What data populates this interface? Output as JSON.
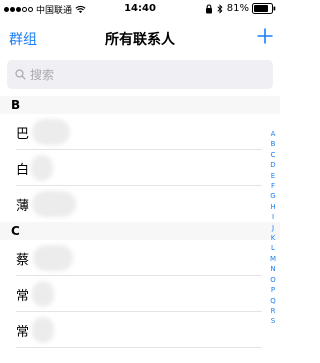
{
  "status_bar": {
    "carrier": "中国联通",
    "time": "14:40",
    "battery": "81%"
  },
  "nav": {
    "left_label": "群组",
    "title": "所有联系人",
    "add_symbol": "+"
  },
  "search": {
    "placeholder": "搜索"
  },
  "sections": [
    {
      "letter": "B",
      "contacts": [
        "巴",
        "白",
        "薄"
      ]
    },
    {
      "letter": "C",
      "contacts": [
        "蔡",
        "常",
        "常"
      ]
    }
  ],
  "index_letters": [
    "A",
    "B",
    "C",
    "D",
    "E",
    "F",
    "G",
    "H",
    "I",
    "J",
    "K",
    "L",
    "M",
    "N",
    "O",
    "P",
    "Q",
    "R",
    "S"
  ],
  "colors": {
    "accent": "#1a7ff5"
  }
}
